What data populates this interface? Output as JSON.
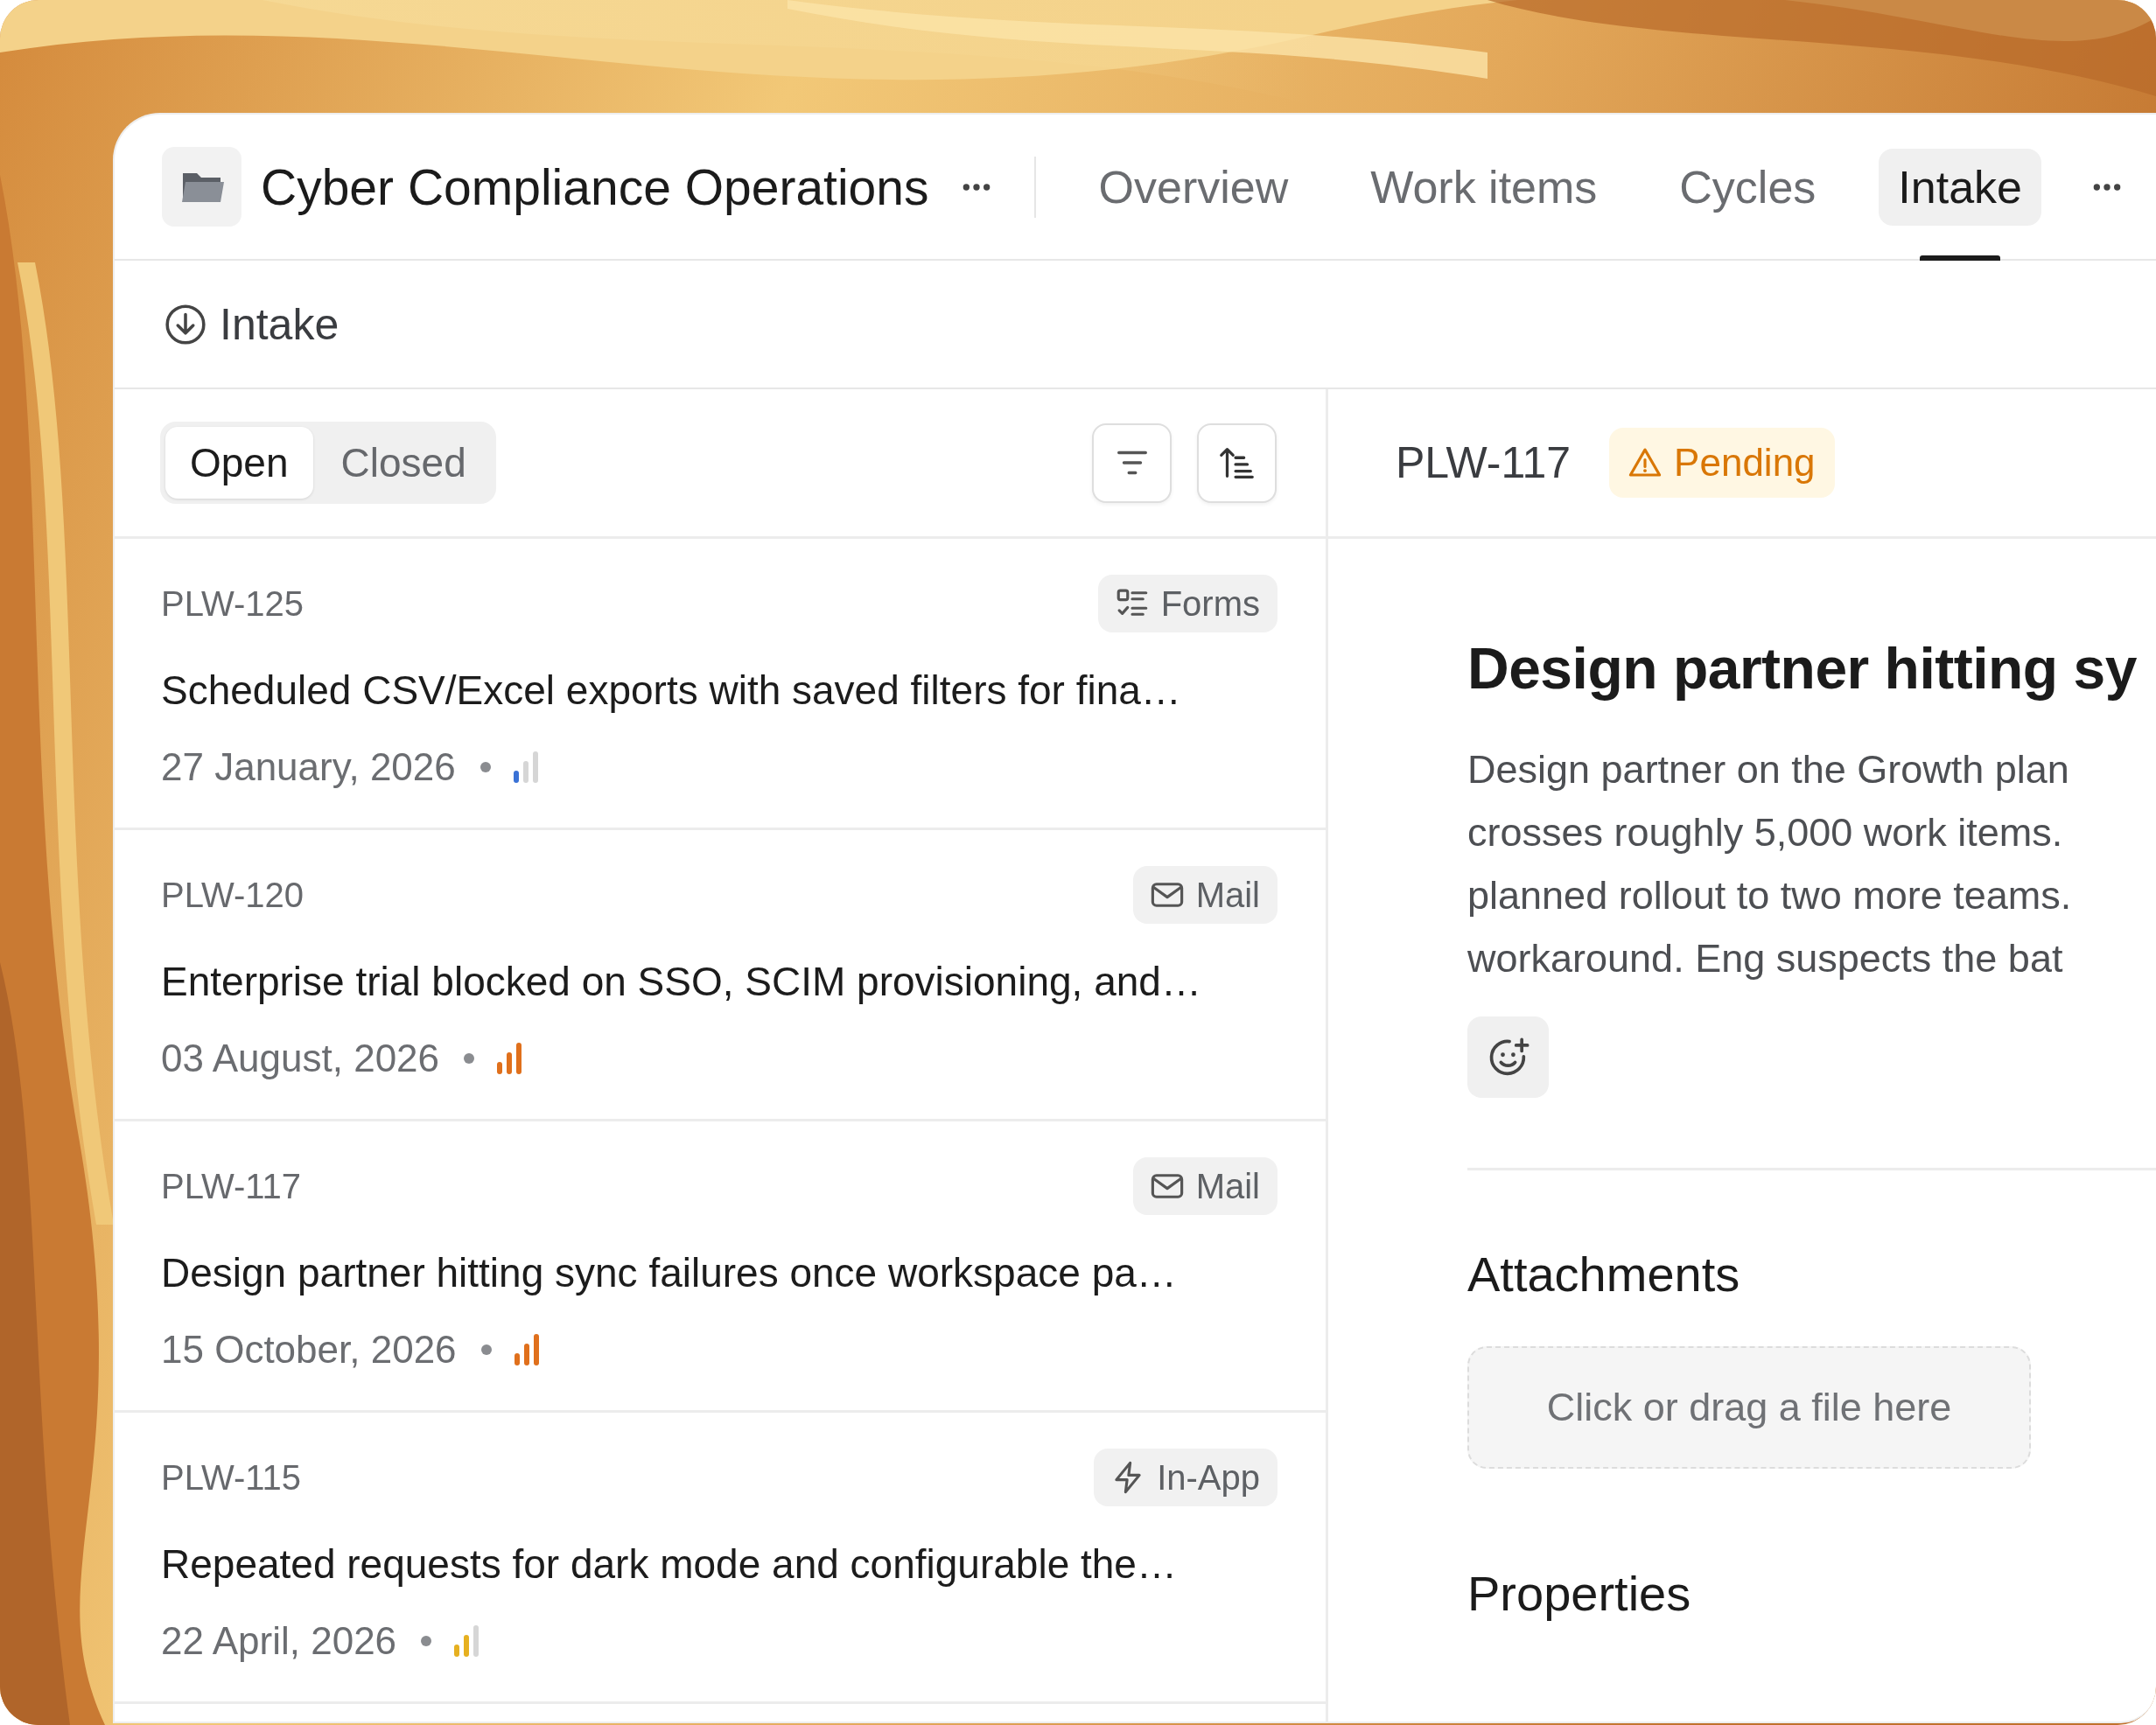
{
  "project": {
    "title": "Cyber Compliance Operations"
  },
  "tabs": [
    {
      "label": "Overview",
      "selected": false
    },
    {
      "label": "Work items",
      "selected": false
    },
    {
      "label": "Cycles",
      "selected": false
    },
    {
      "label": "Intake",
      "selected": true
    }
  ],
  "page_title": "Intake",
  "filter_tabs": [
    {
      "label": "Open",
      "selected": true
    },
    {
      "label": "Closed",
      "selected": false
    }
  ],
  "items": [
    {
      "id": "PLW-125",
      "source": {
        "kind": "forms",
        "label": "Forms"
      },
      "title": "Scheduled CSV/Excel exports with saved filters for fina…",
      "date": "27 January, 2026",
      "priority": {
        "kind": "low"
      }
    },
    {
      "id": "PLW-120",
      "source": {
        "kind": "mail",
        "label": "Mail"
      },
      "title": "Enterprise trial blocked on SSO, SCIM provisioning, and…",
      "date": "03 August, 2026",
      "priority": {
        "kind": "high"
      }
    },
    {
      "id": "PLW-117",
      "source": {
        "kind": "mail",
        "label": "Mail"
      },
      "title": "Design partner hitting sync failures once workspace pa…",
      "date": "15 October, 2026",
      "priority": {
        "kind": "high"
      }
    },
    {
      "id": "PLW-115",
      "source": {
        "kind": "in_app",
        "label": "In-App"
      },
      "title": "Repeated requests for dark mode and configurable the…",
      "date": "22 April, 2026",
      "priority": {
        "kind": "medium"
      }
    }
  ],
  "detail": {
    "id": "PLW-117",
    "status": {
      "kind": "pending",
      "label": "Pending"
    },
    "title": "Design partner hitting sy",
    "description_lines": [
      "Design partner on the Growth plan",
      "crosses roughly 5,000 work items.",
      "planned rollout to two more teams.",
      "workaround. Eng suspects the bat"
    ],
    "attachments_heading": "Attachments",
    "dropzone": "Click or drag a file here",
    "properties_heading": "Properties"
  }
}
